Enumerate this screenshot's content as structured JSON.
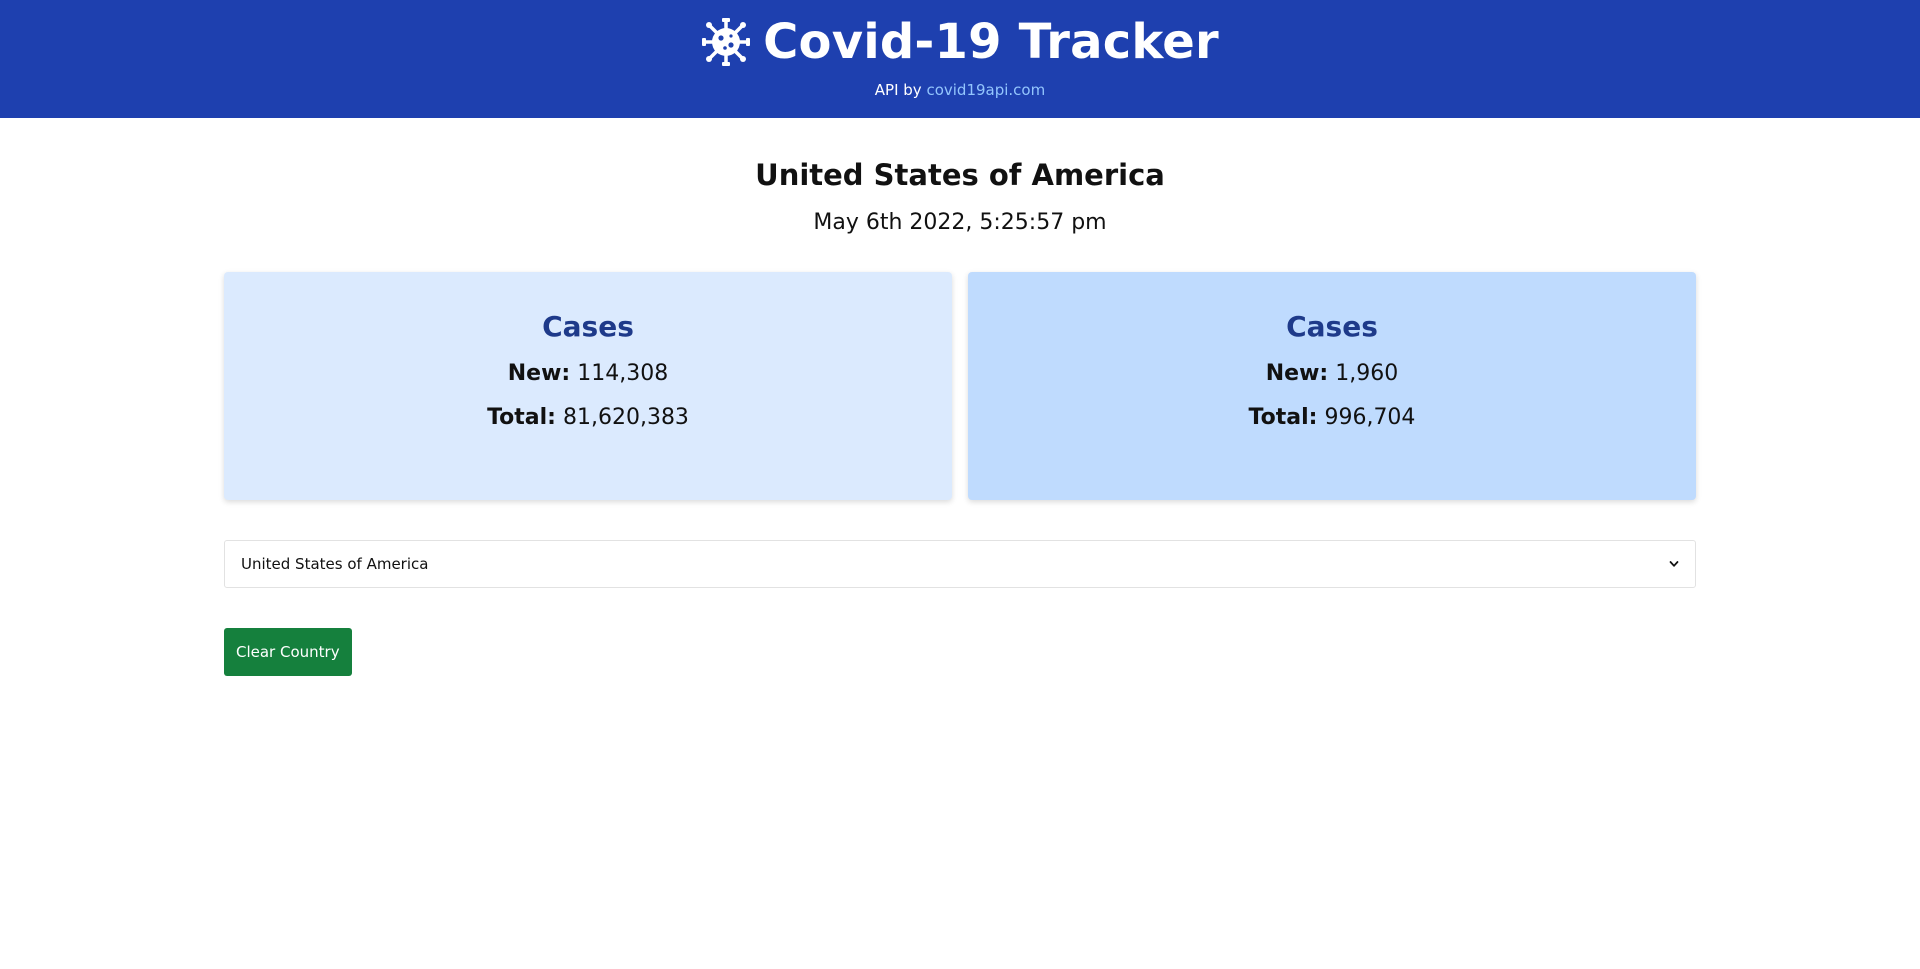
{
  "header": {
    "title": "Covid-19 Tracker",
    "icon": "virus-icon",
    "api_prefix": "API by",
    "api_link_text": "covid19api.com"
  },
  "main": {
    "country": "United States of America",
    "timestamp": "May 6th 2022, 5:25:57 pm",
    "cards": [
      {
        "title": "Cases",
        "new_label": "New:",
        "new_value": "114,308",
        "total_label": "Total:",
        "total_value": "81,620,383"
      },
      {
        "title": "Cases",
        "new_label": "New:",
        "new_value": "1,960",
        "total_label": "Total:",
        "total_value": "996,704"
      }
    ],
    "select": {
      "selected": "United States of America"
    },
    "clear_button_label": "Clear Country"
  },
  "colors": {
    "header_bg": "#1e40af",
    "link": "#93c5fd",
    "card_left_bg": "#dbeafe",
    "card_right_bg": "#bfdbfe",
    "card_title": "#1e3a8a",
    "button_bg": "#15803d"
  }
}
